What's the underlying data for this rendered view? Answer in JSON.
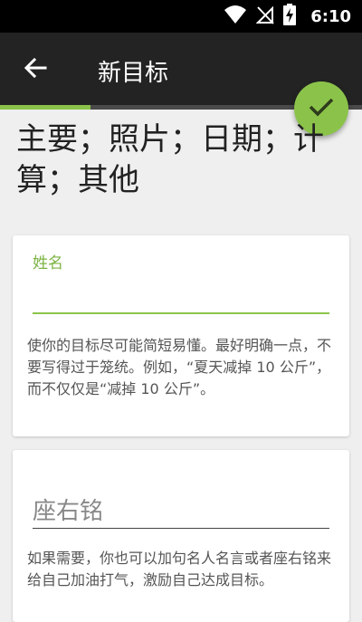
{
  "status_bar": {
    "time": "6:10",
    "icons": [
      "wifi-icon",
      "no-signal-icon",
      "battery-charging-icon"
    ]
  },
  "app_bar": {
    "title": "新目标",
    "back_icon": "arrow-back-icon",
    "confirm_icon": "check-icon"
  },
  "progress": {
    "fraction": 0.25
  },
  "tabs_heading": "主要；照片；日期；计算；其他",
  "fields": [
    {
      "label": "姓名",
      "value": "",
      "helper": "使你的目标尽可能简短易懂。最好明确一点，不要写得过于笼统。例如，“夏天减掉 10 公斤”，而不仅仅是“减掉 10 公斤”。"
    },
    {
      "placeholder": "座右铭",
      "value": "",
      "helper": "如果需要，你也可以加句名人名言或者座右铭来给自己加油打气，激励自己达成目标。"
    }
  ],
  "colors": {
    "accent": "#8bc34a",
    "app_bar": "#232323",
    "status_bar": "#000000",
    "background": "#efefef"
  }
}
